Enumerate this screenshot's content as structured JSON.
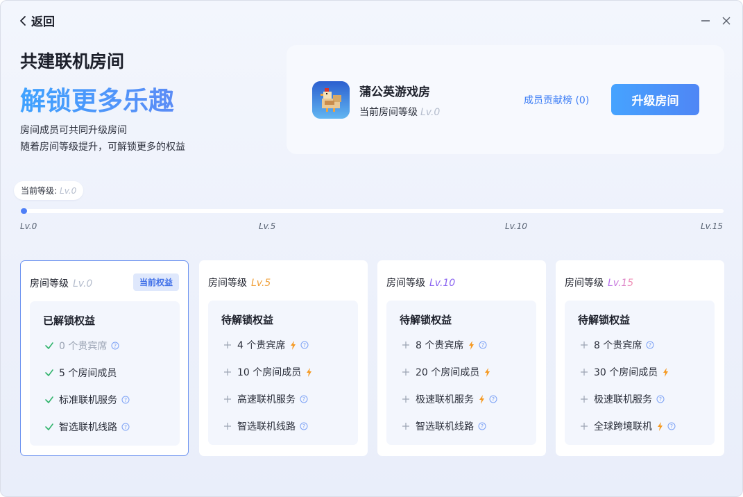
{
  "nav": {
    "back_label": "返回"
  },
  "hero": {
    "title": "共建联机房间",
    "slogan": "解锁更多乐趣",
    "desc_line1": "房间成员可共同升级房间",
    "desc_line2": "随着房间等级提升，可解锁更多的权益"
  },
  "room": {
    "name": "蒲公英游戏房",
    "level_label": "当前房间等级",
    "level_value": "Lv.0",
    "contrib_label": "成员贡献榜 (0)",
    "upgrade_label": "升级房间"
  },
  "progress": {
    "current_label": "当前等级:",
    "current_value": "Lv.0",
    "fraction": 0,
    "ticks": [
      "Lv.0",
      "Lv.5",
      "Lv.10",
      "Lv.15"
    ]
  },
  "colors": {
    "accent": "#4e7ff7",
    "lv0": "#b5bdcd",
    "lv5": "#f0a13c",
    "lv10": "#8a64f0",
    "lv15_from": "#b46ef0",
    "lv15_to": "#f48fb0",
    "bolt": "#f59a23",
    "check": "#2fb36b"
  },
  "levels": [
    {
      "head": "房间等级",
      "lv": "Lv.0",
      "badge": "当前权益",
      "section": "已解锁权益",
      "items": [
        {
          "text": "0 个贵宾席",
          "mark": "check-icon",
          "boost": false,
          "help": true,
          "disabled": true
        },
        {
          "text": "5 个房间成员",
          "mark": "check-icon",
          "boost": false,
          "help": false,
          "disabled": false
        },
        {
          "text": "标准联机服务",
          "mark": "check-icon",
          "boost": false,
          "help": true,
          "disabled": false
        },
        {
          "text": "智选联机线路",
          "mark": "check-icon",
          "boost": false,
          "help": true,
          "disabled": false
        }
      ]
    },
    {
      "head": "房间等级",
      "lv": "Lv.5",
      "section": "待解锁权益",
      "items": [
        {
          "text": "4 个贵宾席",
          "mark": "plus-icon",
          "boost": true,
          "help": true
        },
        {
          "text": "10 个房间成员",
          "mark": "plus-icon",
          "boost": true,
          "help": false
        },
        {
          "text": "高速联机服务",
          "mark": "plus-icon",
          "boost": false,
          "help": true
        },
        {
          "text": "智选联机线路",
          "mark": "plus-icon",
          "boost": false,
          "help": true
        }
      ]
    },
    {
      "head": "房间等级",
      "lv": "Lv.10",
      "section": "待解锁权益",
      "items": [
        {
          "text": "8 个贵宾席",
          "mark": "plus-icon",
          "boost": true,
          "help": true
        },
        {
          "text": "20 个房间成员",
          "mark": "plus-icon",
          "boost": true,
          "help": false
        },
        {
          "text": "极速联机服务",
          "mark": "plus-icon",
          "boost": true,
          "help": true
        },
        {
          "text": "智选联机线路",
          "mark": "plus-icon",
          "boost": false,
          "help": true
        }
      ]
    },
    {
      "head": "房间等级",
      "lv": "Lv.15",
      "section": "待解锁权益",
      "items": [
        {
          "text": "8 个贵宾席",
          "mark": "plus-icon",
          "boost": false,
          "help": true
        },
        {
          "text": "30 个房间成员",
          "mark": "plus-icon",
          "boost": true,
          "help": false
        },
        {
          "text": "极速联机服务",
          "mark": "plus-icon",
          "boost": false,
          "help": true
        },
        {
          "text": "全球跨境联机",
          "mark": "plus-icon",
          "boost": true,
          "help": true
        }
      ]
    }
  ]
}
